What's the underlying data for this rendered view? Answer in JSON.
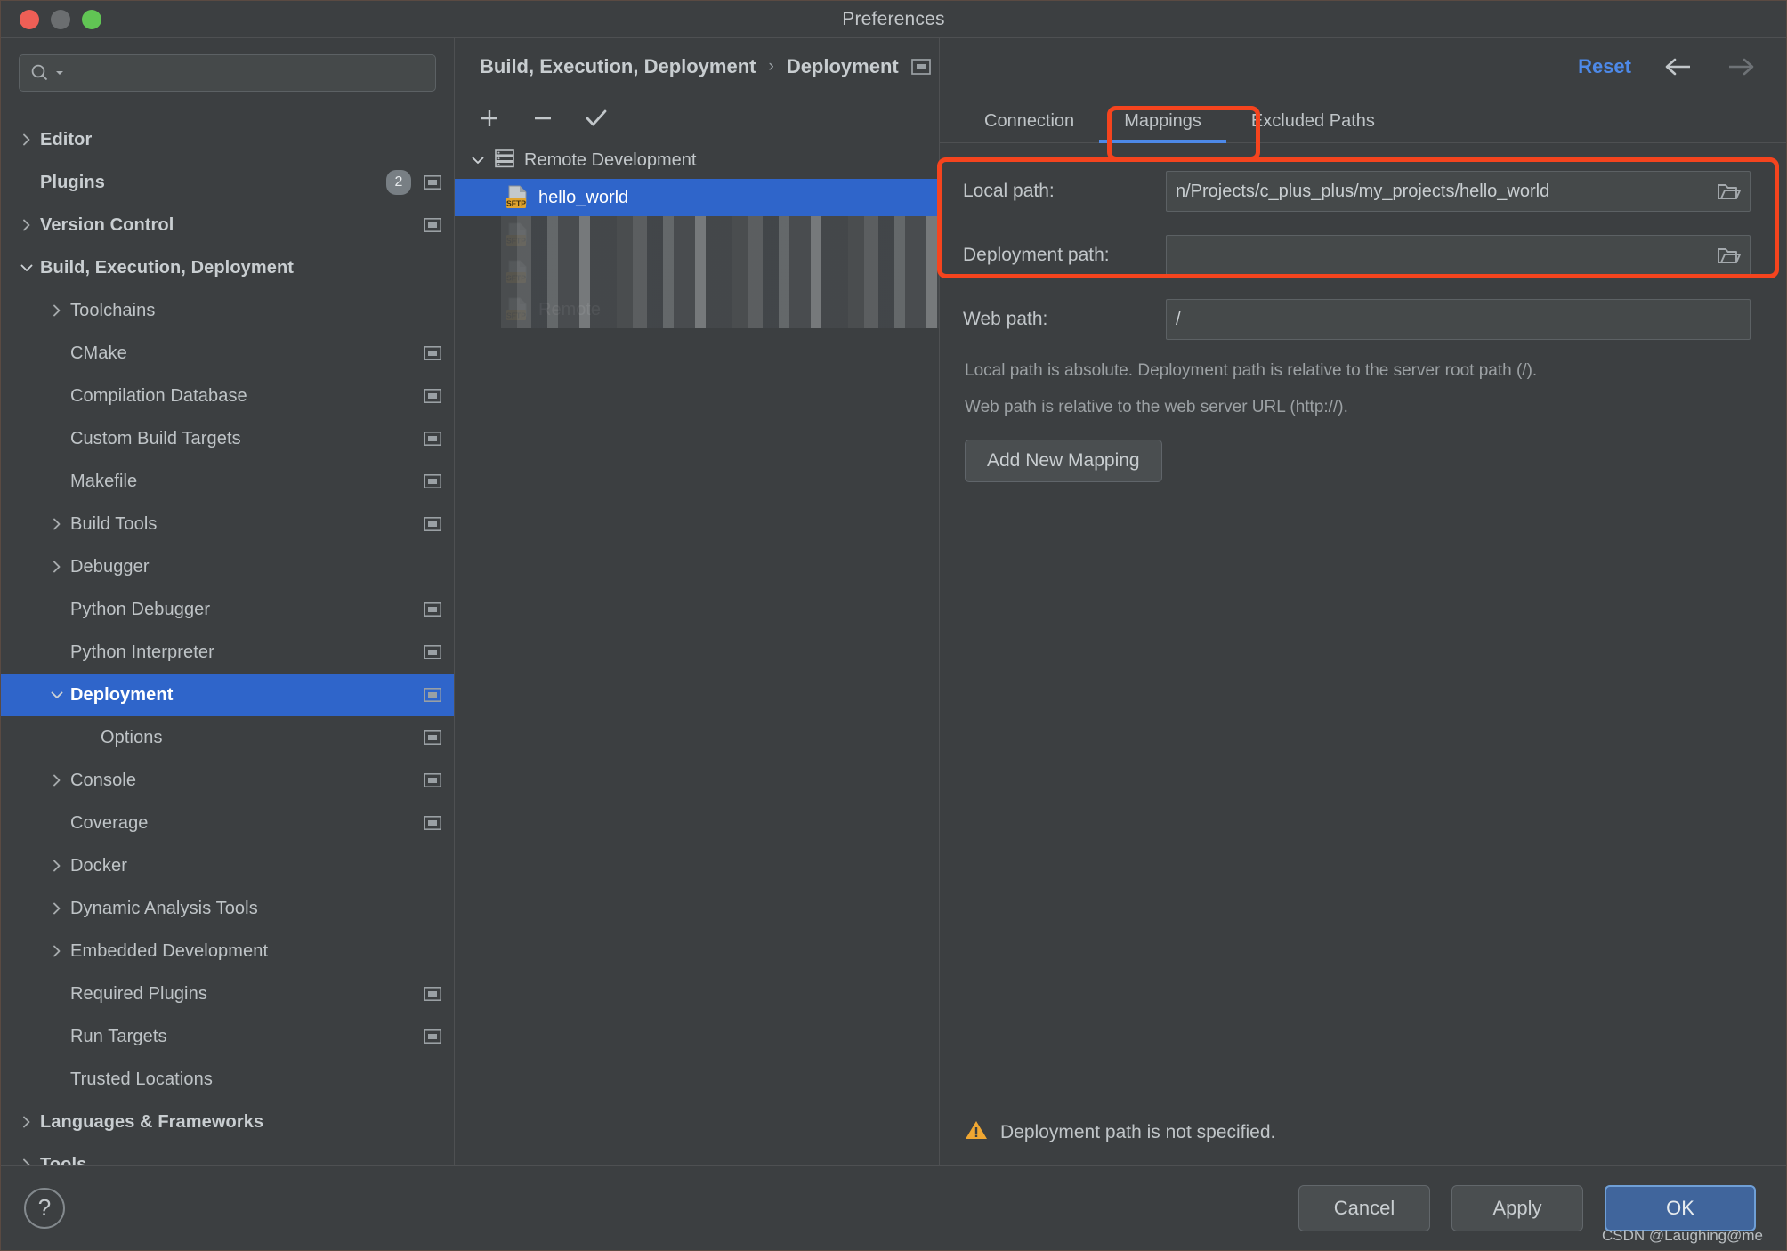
{
  "window": {
    "title": "Preferences",
    "traffic_lights": [
      "close",
      "minimize",
      "zoom"
    ]
  },
  "colors": {
    "accent_blue": "#2f65ca",
    "link_blue": "#4d89e8",
    "annotation_red": "#f5441e",
    "warning_amber": "#f0a732",
    "panel_bg": "#3c3f41",
    "input_bg": "#45494a"
  },
  "sidebar": {
    "search": {
      "value": "",
      "placeholder": ""
    },
    "items": [
      {
        "label": "Editor",
        "level": 0,
        "bold": true,
        "twisty": "right",
        "badge": null,
        "count": null,
        "selected": false
      },
      {
        "label": "Plugins",
        "level": 0,
        "bold": true,
        "twisty": "none",
        "badge": true,
        "count": "2",
        "selected": false
      },
      {
        "label": "Version Control",
        "level": 0,
        "bold": true,
        "twisty": "right",
        "badge": true,
        "count": null,
        "selected": false
      },
      {
        "label": "Build, Execution, Deployment",
        "level": 0,
        "bold": true,
        "twisty": "down",
        "badge": null,
        "count": null,
        "selected": false
      },
      {
        "label": "Toolchains",
        "level": 1,
        "bold": false,
        "twisty": "right",
        "badge": null,
        "count": null,
        "selected": false
      },
      {
        "label": "CMake",
        "level": 1,
        "bold": false,
        "twisty": "none",
        "badge": true,
        "count": null,
        "selected": false
      },
      {
        "label": "Compilation Database",
        "level": 1,
        "bold": false,
        "twisty": "none",
        "badge": true,
        "count": null,
        "selected": false
      },
      {
        "label": "Custom Build Targets",
        "level": 1,
        "bold": false,
        "twisty": "none",
        "badge": true,
        "count": null,
        "selected": false
      },
      {
        "label": "Makefile",
        "level": 1,
        "bold": false,
        "twisty": "none",
        "badge": true,
        "count": null,
        "selected": false
      },
      {
        "label": "Build Tools",
        "level": 1,
        "bold": false,
        "twisty": "right",
        "badge": true,
        "count": null,
        "selected": false
      },
      {
        "label": "Debugger",
        "level": 1,
        "bold": false,
        "twisty": "right",
        "badge": null,
        "count": null,
        "selected": false
      },
      {
        "label": "Python Debugger",
        "level": 1,
        "bold": false,
        "twisty": "none",
        "badge": true,
        "count": null,
        "selected": false
      },
      {
        "label": "Python Interpreter",
        "level": 1,
        "bold": false,
        "twisty": "none",
        "badge": true,
        "count": null,
        "selected": false
      },
      {
        "label": "Deployment",
        "level": 1,
        "bold": false,
        "twisty": "down",
        "badge": true,
        "count": null,
        "selected": true
      },
      {
        "label": "Options",
        "level": 2,
        "bold": false,
        "twisty": "none",
        "badge": true,
        "count": null,
        "selected": false
      },
      {
        "label": "Console",
        "level": 1,
        "bold": false,
        "twisty": "right",
        "badge": true,
        "count": null,
        "selected": false
      },
      {
        "label": "Coverage",
        "level": 1,
        "bold": false,
        "twisty": "none",
        "badge": true,
        "count": null,
        "selected": false
      },
      {
        "label": "Docker",
        "level": 1,
        "bold": false,
        "twisty": "right",
        "badge": null,
        "count": null,
        "selected": false
      },
      {
        "label": "Dynamic Analysis Tools",
        "level": 1,
        "bold": false,
        "twisty": "right",
        "badge": null,
        "count": null,
        "selected": false
      },
      {
        "label": "Embedded Development",
        "level": 1,
        "bold": false,
        "twisty": "right",
        "badge": null,
        "count": null,
        "selected": false
      },
      {
        "label": "Required Plugins",
        "level": 1,
        "bold": false,
        "twisty": "none",
        "badge": true,
        "count": null,
        "selected": false
      },
      {
        "label": "Run Targets",
        "level": 1,
        "bold": false,
        "twisty": "none",
        "badge": true,
        "count": null,
        "selected": false
      },
      {
        "label": "Trusted Locations",
        "level": 1,
        "bold": false,
        "twisty": "none",
        "badge": null,
        "count": null,
        "selected": false
      },
      {
        "label": "Languages & Frameworks",
        "level": 0,
        "bold": true,
        "twisty": "right",
        "badge": null,
        "count": null,
        "selected": false
      },
      {
        "label": "Tools",
        "level": 0,
        "bold": true,
        "twisty": "right",
        "badge": null,
        "count": null,
        "selected": false
      }
    ]
  },
  "breadcrumb": {
    "parent": "Build, Execution, Deployment",
    "separator": "›",
    "current": "Deployment"
  },
  "header": {
    "reset_label": "Reset",
    "back_icon": "arrow-left-icon",
    "forward_icon": "arrow-right-icon"
  },
  "server_toolbar": {
    "add_icon": "plus-icon",
    "remove_icon": "minus-icon",
    "default_icon": "check-icon"
  },
  "server_tree": {
    "root": {
      "label": "Remote Development",
      "icon": "server-group-icon",
      "expanded": true
    },
    "items": [
      {
        "label": "hello_world",
        "icon": "sftp-icon",
        "selected": true,
        "redacted": false
      },
      {
        "label": "",
        "icon": "sftp-icon",
        "selected": false,
        "redacted": true
      },
      {
        "label": "",
        "icon": "sftp-icon",
        "selected": false,
        "redacted": true
      },
      {
        "label": "Remote",
        "icon": "sftp-icon",
        "selected": false,
        "redacted": true
      }
    ]
  },
  "tabs": [
    {
      "label": "Connection",
      "active": false
    },
    {
      "label": "Mappings",
      "active": true,
      "highlighted": true
    },
    {
      "label": "Excluded Paths",
      "active": false
    }
  ],
  "mappings_form": {
    "fields": [
      {
        "label": "Local path:",
        "value": "n/Projects/c_plus_plus/my_projects/hello_world",
        "placeholder": "",
        "has_browse": true,
        "browse_icon": "folder-icon"
      },
      {
        "label": "Deployment path:",
        "value": "",
        "placeholder": "",
        "has_browse": true,
        "browse_icon": "folder-icon"
      },
      {
        "label": "Web path:",
        "value": "/",
        "placeholder": "",
        "has_browse": false,
        "browse_icon": ""
      }
    ],
    "hint_line1": "Local path is absolute. Deployment path is relative to the server root path (/).",
    "hint_line2": "Web path is relative to the web server URL (http://).",
    "add_mapping_label": "Add New Mapping"
  },
  "warning": {
    "icon": "warning-triangle-icon",
    "text": "Deployment path is not specified."
  },
  "footer": {
    "help_label": "?",
    "cancel_label": "Cancel",
    "apply_label": "Apply",
    "ok_label": "OK"
  },
  "watermark": "CSDN @Laughing@me"
}
